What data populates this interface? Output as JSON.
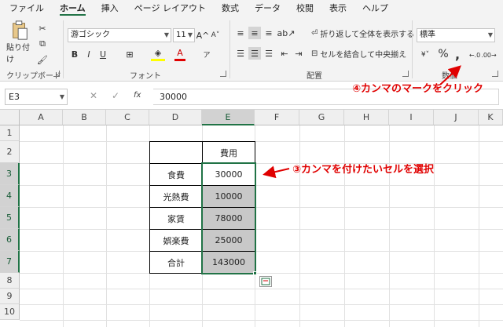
{
  "tabs": [
    "ファイル",
    "ホーム",
    "挿入",
    "ページ レイアウト",
    "数式",
    "データ",
    "校閲",
    "表示",
    "ヘルプ"
  ],
  "ribbon": {
    "clipboard": {
      "paste_label": "貼り付け",
      "group": "クリップボード"
    },
    "font": {
      "font_name": "游ゴシック",
      "font_size": "11",
      "group": "フォント",
      "bold": "B",
      "italic": "I",
      "underline": "U"
    },
    "alignment": {
      "wrap_label": "折り返して全体を表示する",
      "merge_label": "セルを結合して中央揃え",
      "group": "配置"
    },
    "number": {
      "format": "標準",
      "percent": "%",
      "group": "数値"
    }
  },
  "formula_bar": {
    "name_box": "E3",
    "fx": "fx",
    "value": "30000"
  },
  "columns": [
    "A",
    "B",
    "C",
    "D",
    "E",
    "F",
    "G",
    "H",
    "I",
    "J",
    "K"
  ],
  "rows": [
    "1",
    "2",
    "3",
    "4",
    "5",
    "6",
    "7",
    "8",
    "9",
    "10"
  ],
  "table": {
    "header": "費用",
    "rows": [
      {
        "label": "食費",
        "value": "30000"
      },
      {
        "label": "光熱費",
        "value": "10000"
      },
      {
        "label": "家賃",
        "value": "78000"
      },
      {
        "label": "娯楽費",
        "value": "25000"
      },
      {
        "label": "合計",
        "value": "143000"
      }
    ]
  },
  "annotations": {
    "step3": "③カンマを付けたいセルを選択",
    "step4": "④カンマのマークをクリック"
  },
  "colors": {
    "accent": "#217346",
    "annotation": "#e00000"
  }
}
